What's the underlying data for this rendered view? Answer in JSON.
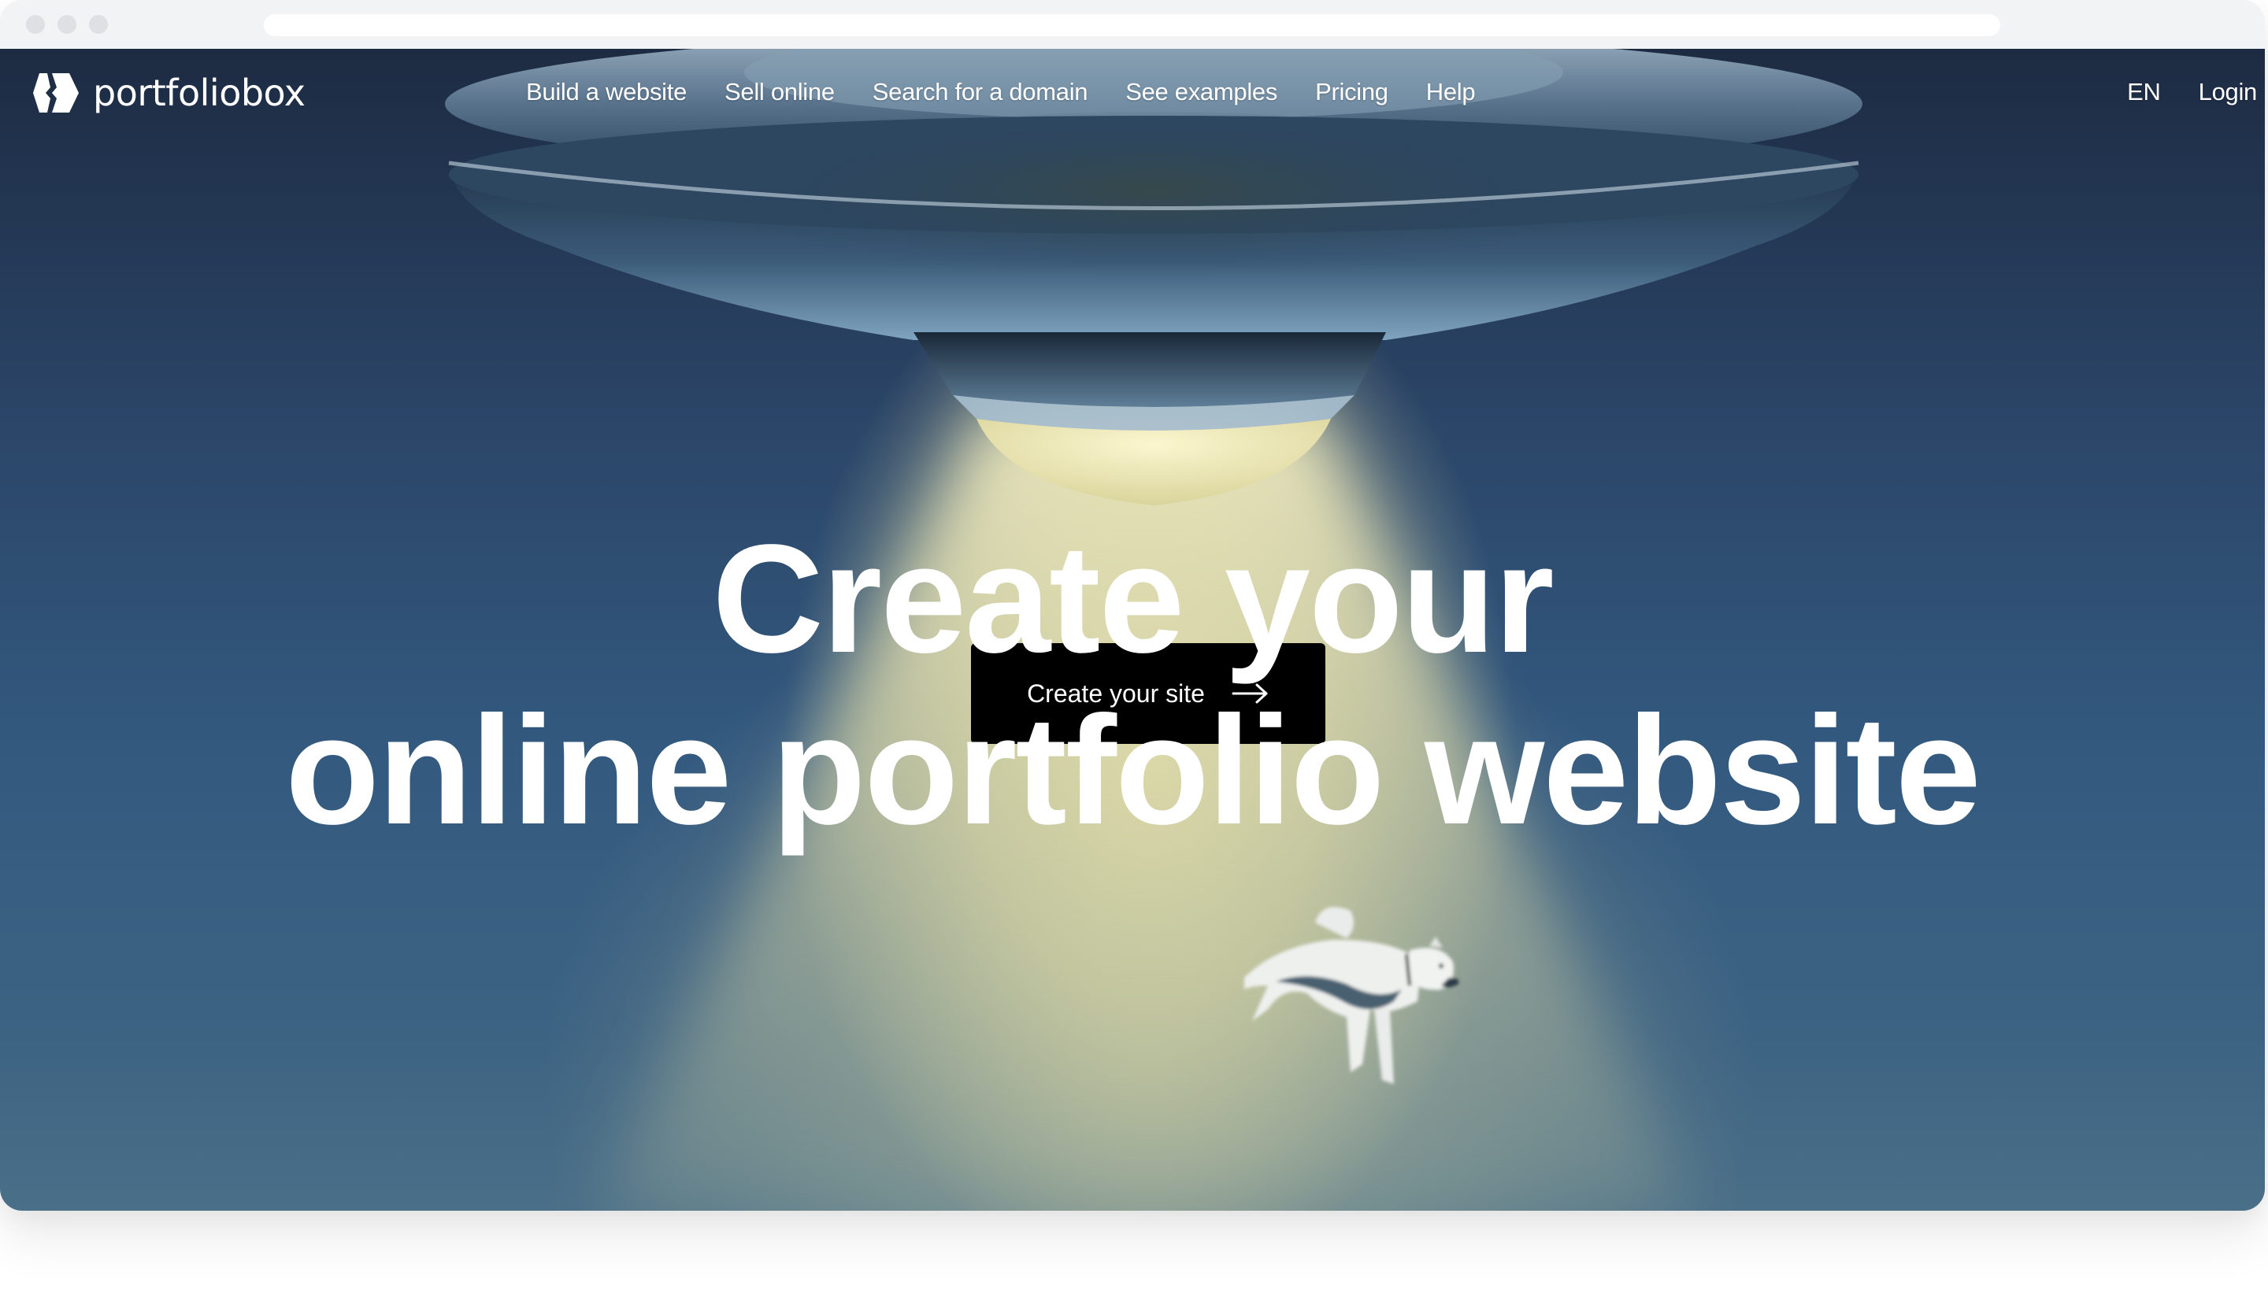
{
  "browser": {
    "traffic_lights": [
      "close",
      "minimize",
      "maximize"
    ],
    "address_bar_value": ""
  },
  "brand": {
    "name": "portfoliobox",
    "logo_icon": "portfoliobox-logo-icon"
  },
  "nav": {
    "items": [
      {
        "label": "Build a website"
      },
      {
        "label": "Sell online"
      },
      {
        "label": "Search for a domain"
      },
      {
        "label": "See examples"
      },
      {
        "label": "Pricing"
      },
      {
        "label": "Help"
      }
    ],
    "language": "EN",
    "login": "Login"
  },
  "hero": {
    "headline_line1": "Create your",
    "headline_line2": "online portfolio website",
    "cta_label": "Create your site",
    "cta_icon": "arrow-right-icon",
    "illustration": "ufo-abducting-dog"
  },
  "colors": {
    "chrome_bg": "#f2f3f5",
    "hero_dark": "#1d2b42",
    "hero_mid": "#33597f",
    "beam": "#dedcaa",
    "cta_bg": "#000000",
    "text": "#ffffff"
  }
}
